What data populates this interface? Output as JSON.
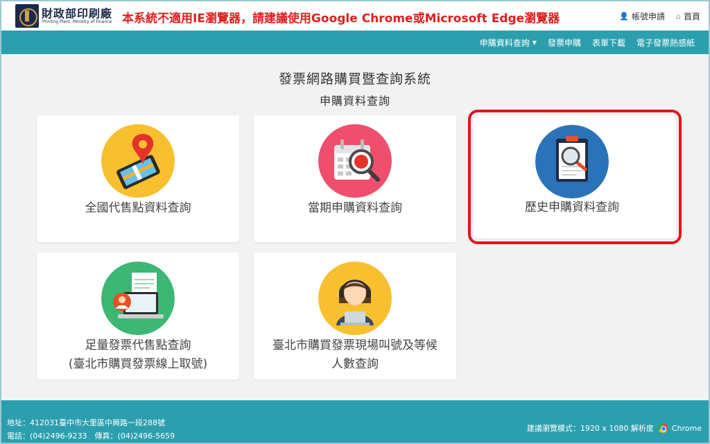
{
  "header": {
    "logo_text": "財政部印刷廠",
    "logo_subtitle": "Printing Plant, Ministry of Finance",
    "notice": "本系統不適用IE瀏覽器，請建議使用Google Chrome或Microsoft Edge瀏覽器",
    "links": [
      {
        "label": "帳號申請",
        "icon": "person-icon"
      },
      {
        "label": "首頁",
        "icon": "home-icon"
      }
    ]
  },
  "nav": {
    "items": [
      {
        "label": "申購資料查詢",
        "dropdown": true
      },
      {
        "label": "發票申購"
      },
      {
        "label": "表單下載"
      },
      {
        "label": "電子發票熱感紙"
      }
    ]
  },
  "page": {
    "title": "發票網路購買暨查詢系統",
    "subtitle": "申購資料查詢"
  },
  "cards": [
    {
      "label": "全國代售點資料查詢",
      "icon": "map-pin-phone-icon",
      "color": "#f8c02f"
    },
    {
      "label": "當期申購資料查詢",
      "icon": "calendar-search-icon",
      "color": "#ef4f6d"
    },
    {
      "label": "歷史申購資料查詢",
      "icon": "clipboard-search-icon",
      "color": "#2a73b8",
      "selected": true
    },
    {
      "label_line1": "足量發票代售點查詢",
      "label_line2": "(臺北市購買發票線上取號)",
      "icon": "laptop-user-icon",
      "color": "#3cb774"
    },
    {
      "label_line1": "臺北市購買發票現場叫號及等候",
      "label_line2": "人數查詢",
      "icon": "operator-headset-icon",
      "color": "#f8c02f"
    }
  ],
  "footer": {
    "address": "地址：412031臺中市大里區中興路一段288號",
    "phone": "電話：(04)2496-9233　傳真：(04)2496-5659",
    "resolution": "建議瀏覽模式：1920 x 1080 解析度",
    "browser": "Chrome"
  },
  "colors": {
    "teal": "#2c9fae",
    "notice_red": "#e0201d",
    "highlight_red": "#e3141b"
  }
}
